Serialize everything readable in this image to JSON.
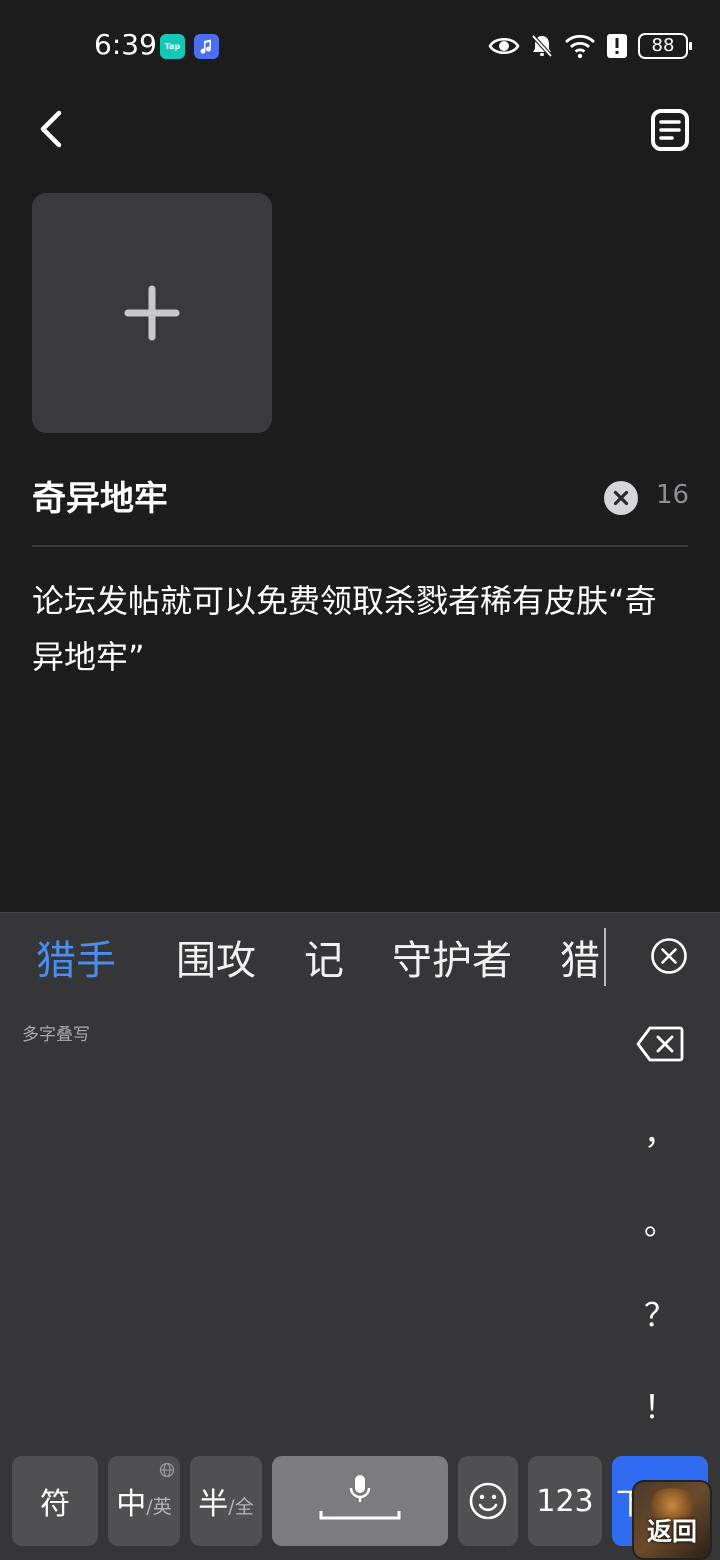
{
  "status_bar": {
    "time": "6:39",
    "tap_badge": "Tap",
    "battery_level": "88",
    "icons": [
      "eye-icon",
      "bell-off-icon",
      "wifi-icon",
      "alert-icon",
      "battery-icon"
    ]
  },
  "post": {
    "title": "奇异地牢",
    "title_char_count": "16",
    "body": "论坛发帖就可以免费领取杀戮者稀有皮肤“奇异地牢”"
  },
  "keyboard": {
    "candidates": [
      "猎手",
      "围攻",
      "记",
      "守护者",
      "猎"
    ],
    "handwriting_mode_label": "多字叠写",
    "punctuation": [
      "，",
      "。",
      "？",
      "！"
    ],
    "keys": {
      "symbol": "符",
      "chinese": "中",
      "english": "/英",
      "half": "半",
      "full": "/全",
      "numbers": "123",
      "enter": "下"
    }
  },
  "floating_return": {
    "label": "返回"
  },
  "colors": {
    "background": "#1c1c1d",
    "keyboard_bg": "#363638",
    "active_candidate": "#4a8ff0",
    "enter_key": "#2f6cf1"
  }
}
